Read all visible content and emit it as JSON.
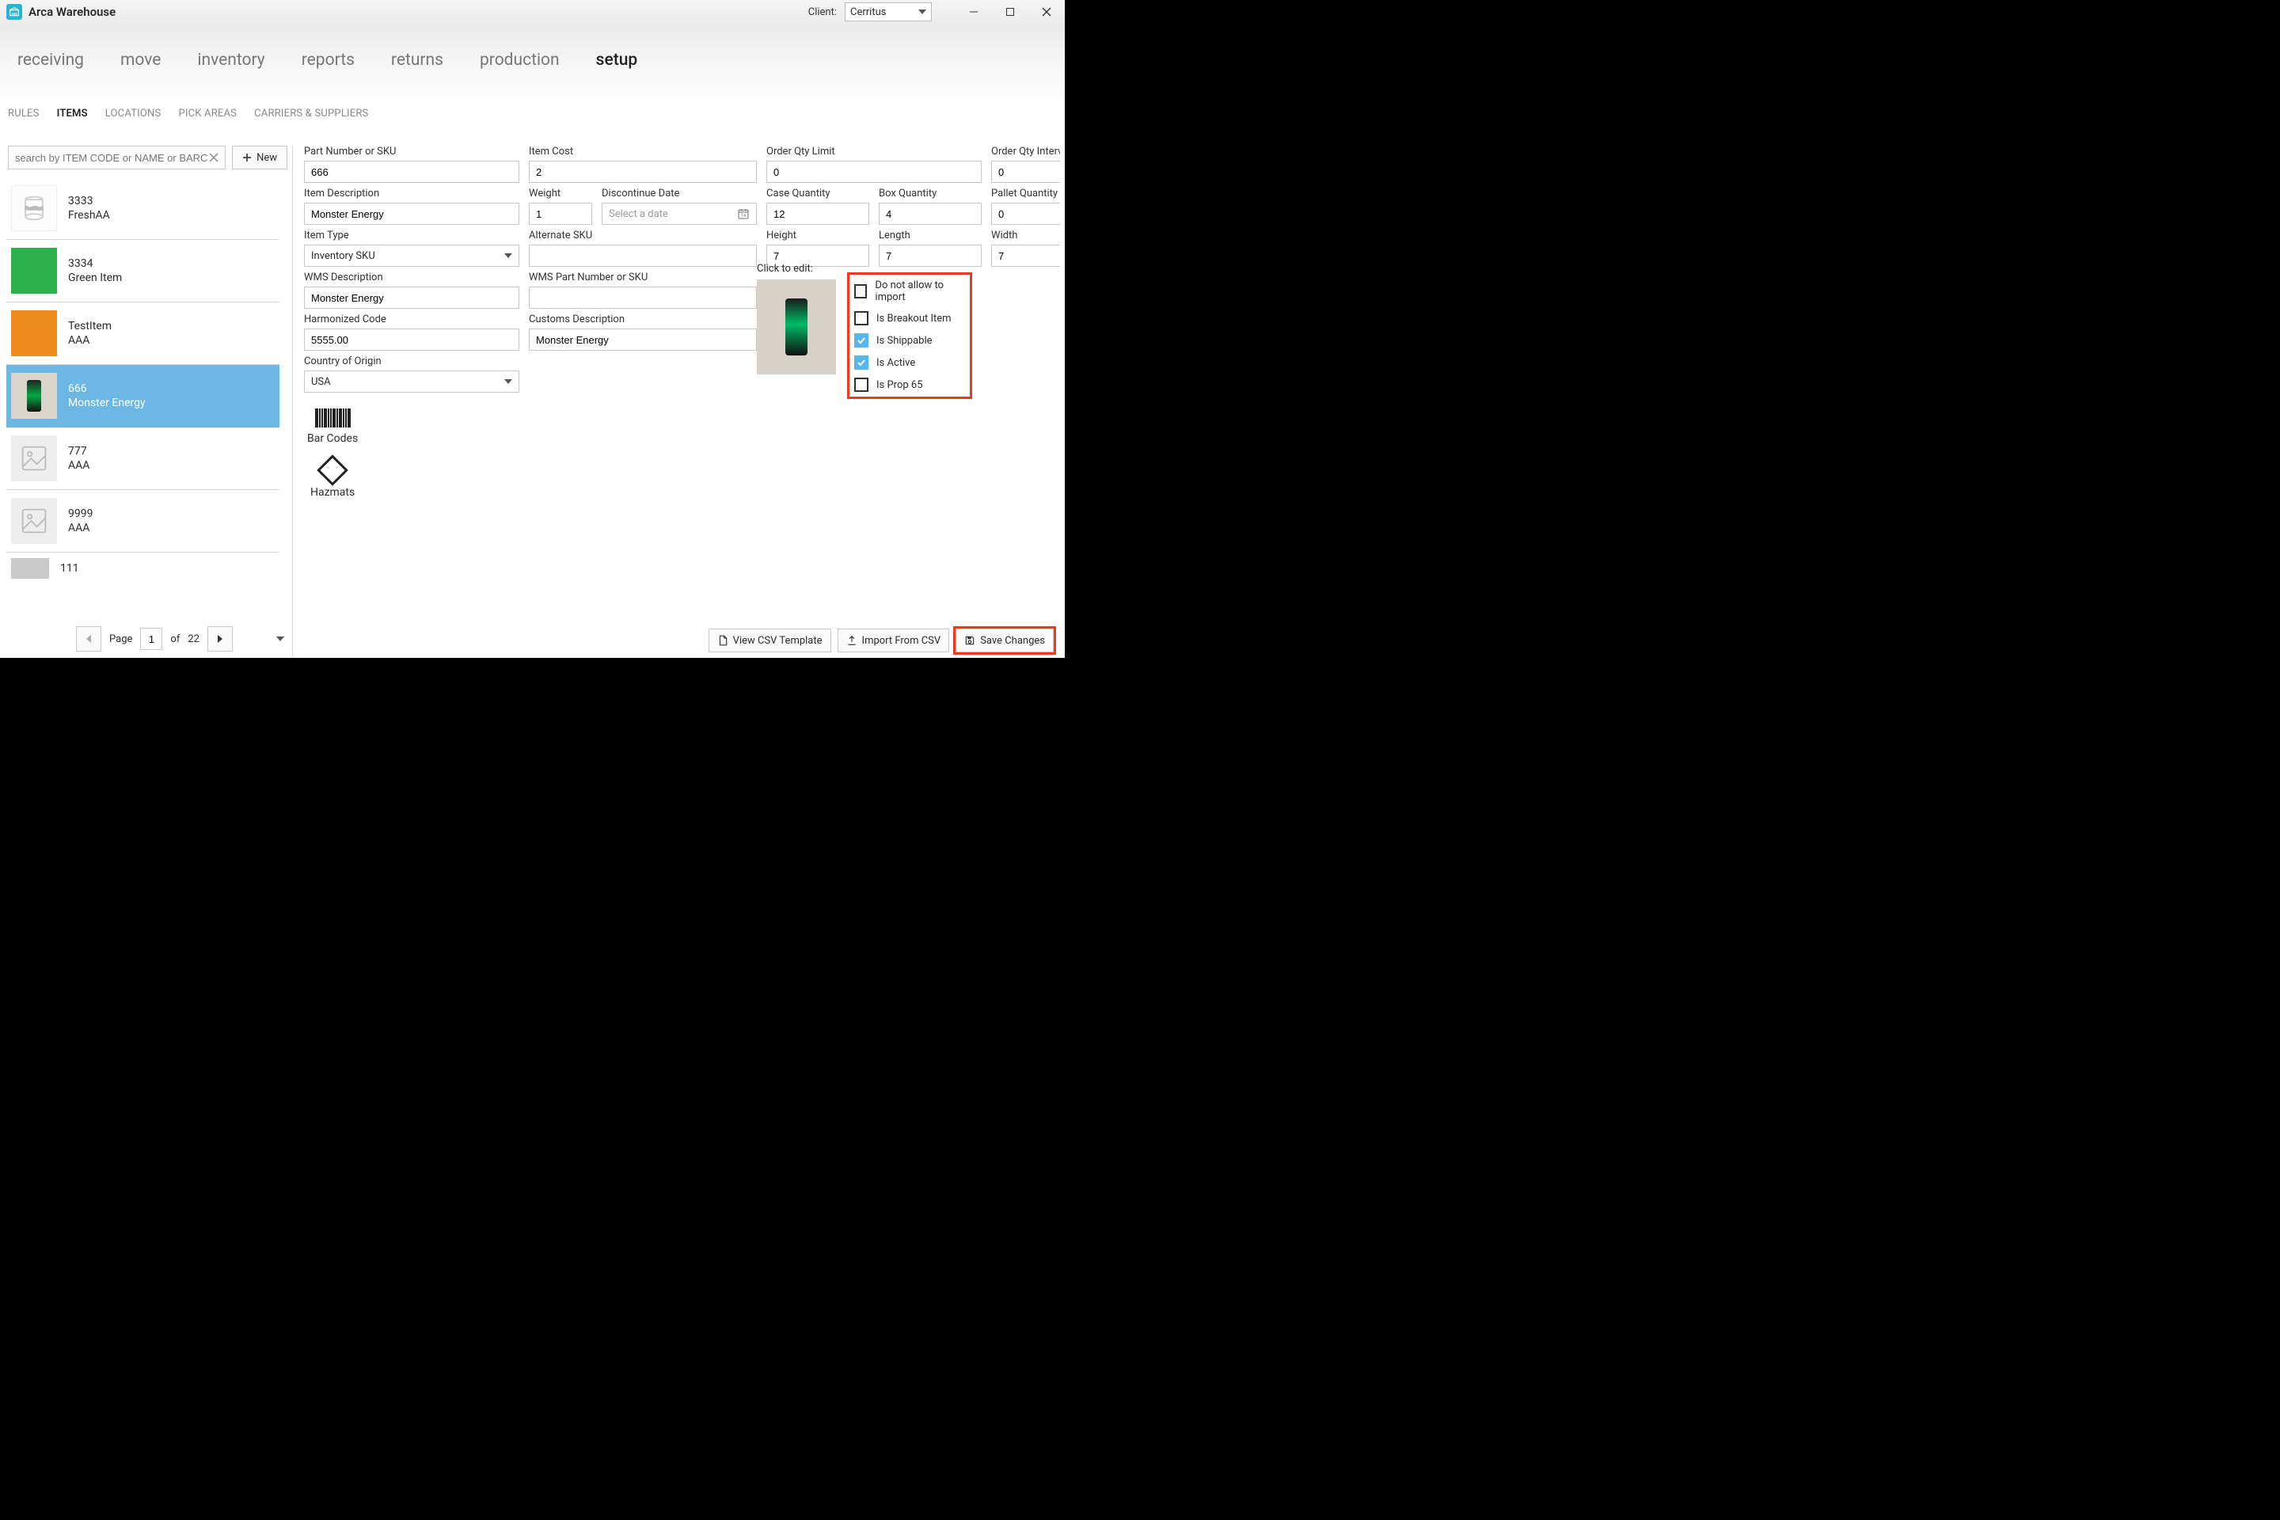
{
  "app_title": "Arca Warehouse",
  "client_label": "Client:",
  "client_selected": "Cerritus",
  "main_nav": [
    "receiving",
    "move",
    "inventory",
    "reports",
    "returns",
    "production",
    "setup"
  ],
  "main_nav_active": 6,
  "sub_tabs": [
    "RULES",
    "ITEMS",
    "LOCATIONS",
    "PICK AREAS",
    "CARRIERS & SUPPLIERS"
  ],
  "sub_tabs_active": 1,
  "search_placeholder": "search by ITEM CODE or NAME or BARCODE",
  "new_btn": "New",
  "items": [
    {
      "code": "3333",
      "name": "FreshAA",
      "thumb": "white"
    },
    {
      "code": "3334",
      "name": "Green Item",
      "thumb": "green"
    },
    {
      "code": "TestItem",
      "name": "AAA",
      "thumb": "orange"
    },
    {
      "code": "666",
      "name": "Monster Energy",
      "thumb": "can",
      "selected": true
    },
    {
      "code": "777",
      "name": "AAA",
      "thumb": "ph"
    },
    {
      "code": "9999",
      "name": "AAA",
      "thumb": "ph"
    },
    {
      "code": "111",
      "name": "",
      "thumb": "shelf"
    }
  ],
  "pager": {
    "page_label": "Page",
    "page": "1",
    "of_label": "of",
    "total": "22"
  },
  "form": {
    "part_number_label": "Part Number or SKU",
    "part_number": "666",
    "item_cost_label": "Item Cost",
    "item_cost": "2",
    "order_qty_limit_label": "Order Qty Limit",
    "order_qty_limit": "0",
    "order_qty_interval_label": "Order Qty Interval",
    "order_qty_interval": "0",
    "item_desc_label": "Item Description",
    "item_desc": "Monster Energy",
    "weight_label": "Weight",
    "weight": "1",
    "discontinue_label": "Discontinue Date",
    "discontinue_placeholder": "Select a date",
    "case_qty_label": "Case Quantity",
    "case_qty": "12",
    "box_qty_label": "Box Quantity",
    "box_qty": "4",
    "pallet_qty_label": "Pallet Quantity",
    "pallet_qty": "0",
    "item_type_label": "Item Type",
    "item_type": "Inventory SKU",
    "alt_sku_label": "Alternate SKU",
    "alt_sku": "",
    "height_label": "Height",
    "height": "7",
    "length_label": "Length",
    "length": "7",
    "width_label": "Width",
    "width": "7",
    "wms_desc_label": "WMS Description",
    "wms_desc": "Monster Energy",
    "wms_part_label": "WMS Part Number or SKU",
    "wms_part": "",
    "click_to_edit": "Click to edit:",
    "harm_code_label": "Harmonized Code",
    "harm_code": "5555.00",
    "customs_desc_label": "Customs Description",
    "customs_desc": "Monster Energy",
    "country_label": "Country of Origin",
    "country": "USA"
  },
  "checks": {
    "no_import": "Do not allow to import",
    "breakout": "Is Breakout Item",
    "shippable": "Is Shippable",
    "active": "Is Active",
    "prop65": "Is Prop 65"
  },
  "barcodes_label": "Bar Codes",
  "hazmats_label": "Hazmats",
  "footer": {
    "view_csv": "View CSV Template",
    "import_csv": "Import From CSV",
    "save": "Save Changes"
  }
}
